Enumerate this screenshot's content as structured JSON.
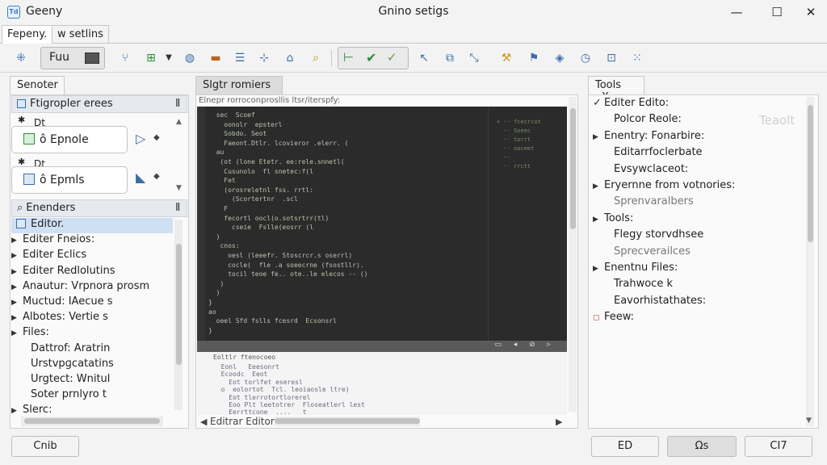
{
  "window": {
    "app_name": "Geeny",
    "title": "Gnino setigs",
    "minimize": "—",
    "maximize": "☐",
    "close": "✕"
  },
  "menubar": {
    "tabs": [
      "Fepeny.",
      "w setlins"
    ]
  },
  "toolbar": {
    "combo_label": "Fuu"
  },
  "left_panel": {
    "tab_label": "Senoter",
    "section1_title": "Ftigropler ereеs",
    "section1_pin": "⫴",
    "entries": [
      {
        "pin": "✱",
        "name": "Dt",
        "box_label": "ô  Epnole",
        "action": "▷",
        "action2": "◆"
      },
      {
        "pin": "✱",
        "name": "Dt",
        "box_label": "ô  Epmls",
        "action": "◣",
        "action2": "◆"
      }
    ],
    "section2_title": "Enenders",
    "section2_pin": "⫴",
    "tree": [
      {
        "label": "Editor.",
        "selected": true,
        "caret": ""
      },
      {
        "label": "Editer Fneios:",
        "caret": "▶"
      },
      {
        "label": "Editer Eclics",
        "caret": "▶"
      },
      {
        "label": "Editer Redlolutins",
        "caret": "▶"
      },
      {
        "label": "Anautur: Vrpnora prosm",
        "caret": "▶"
      },
      {
        "label": "Muctud: IAecue s",
        "caret": "▶"
      },
      {
        "label": "Albotes: Vertie s",
        "caret": "▶"
      },
      {
        "label": "Files:",
        "caret": "▶"
      },
      {
        "label": "Dattrof: Aratrin",
        "caret": ""
      },
      {
        "label": "Urstvpɡcatatins",
        "caret": ""
      },
      {
        "label": "Urgtect: Wnitul",
        "caret": ""
      },
      {
        "label": "Soter prnlyro t",
        "caret": ""
      },
      {
        "label": "Slerc:",
        "caret": "▶"
      }
    ]
  },
  "center_panel": {
    "tab_label": "Slgtr romiers",
    "header_text": "Elnepr rorroconprosllis ltsr/iterspfy:",
    "code_lines": [
      "  sec  Scoef",
      "    oonolr  epsterl",
      "    Sobdo. Seot",
      "    Faeont.Dtlr. lcovieror .elerr. (",
      "  au",
      "   (ot (lone Etetr. ee:rele.snnetl(",
      "    Cusunolo  fl snetec:f(l",
      "    Fet",
      "    (orosreletnl fss. rrtl:",
      "      (Scortertnr  .scl",
      "    F",
      "    fecortl oocl(o.sotsrtrr(tl)",
      "      cseie  Fslle(eosrr (l",
      "  )",
      "   cnos:",
      "     oesl (leeefr. Stoscrcr.s oserrl)",
      "     cocle(  fle .a soeecrne (fsostllr).",
      "     tocil teoe fe.. ote..le elecos -- ()",
      "   )",
      "  )",
      "}",
      "ao",
      "  oeel Sfd fslls fcesrd  Ecsonsrl",
      "}"
    ],
    "lower_header": "Eoltlr ftenocoeo",
    "lower_lines": [
      "  Eonl   Eeesonrt",
      "  Ecoodc  Eeot",
      "    Eot torlfet eseresl",
      "  o  eolortot  Tcl. leoiaosle ltre)",
      "    Eot tlerrotortlorerel",
      "    Eoo Plt leetotrer  Floseatlerl lest",
      "    Eerrttcone  ....   t"
    ],
    "footer_text": "Editrar Editor"
  },
  "right_panel": {
    "tab_label": "Tools",
    "tab_close": "X",
    "ghost_text": "Teaolt",
    "items": [
      {
        "label": "Editer Edito:",
        "mark": "✓",
        "indent": 0,
        "color": "#222222"
      },
      {
        "label": "Polcor Reole:",
        "mark": "",
        "indent": 1,
        "color": "#222222"
      },
      {
        "label": "Enentry: Fonarbire:",
        "mark": "▶",
        "indent": 0,
        "color": "#222222"
      },
      {
        "label": "Editarrfoclerbate",
        "mark": "",
        "indent": 1,
        "color": "#222222"
      },
      {
        "label": "Evsywclaceot:",
        "mark": "",
        "indent": 1,
        "color": "#222222"
      },
      {
        "label": "Eryernne from votnories:",
        "mark": "▶",
        "indent": 0,
        "color": "#222222"
      },
      {
        "label": "Sprenvaralbers",
        "mark": "",
        "indent": 1,
        "color": "#777777"
      },
      {
        "label": "Tools:",
        "mark": "▶",
        "indent": 0,
        "color": "#222222"
      },
      {
        "label": "Flegy storvdhsee",
        "mark": "",
        "indent": 1,
        "color": "#222222"
      },
      {
        "label": "Sprecverailces",
        "mark": "",
        "indent": 1,
        "color": "#777777"
      },
      {
        "label": "Enentnu Files:",
        "mark": "▶",
        "indent": 0,
        "color": "#222222"
      },
      {
        "label": "Trahwoce k",
        "mark": "",
        "indent": 1,
        "color": "#222222"
      },
      {
        "label": "Eavorhistathates:",
        "mark": "",
        "indent": 1,
        "color": "#222222"
      },
      {
        "label": "Feew:",
        "mark": "▢",
        "indent": 0,
        "color": "#222222"
      }
    ]
  },
  "footer": {
    "left_button": "Cnib",
    "btn1": "ED",
    "btn2": "Ωs",
    "btn3": "CI7"
  },
  "colors": {
    "accent": "#3a6ea8",
    "code_bg": "#2b2b2b",
    "selected_row": "#cfe0f5"
  }
}
